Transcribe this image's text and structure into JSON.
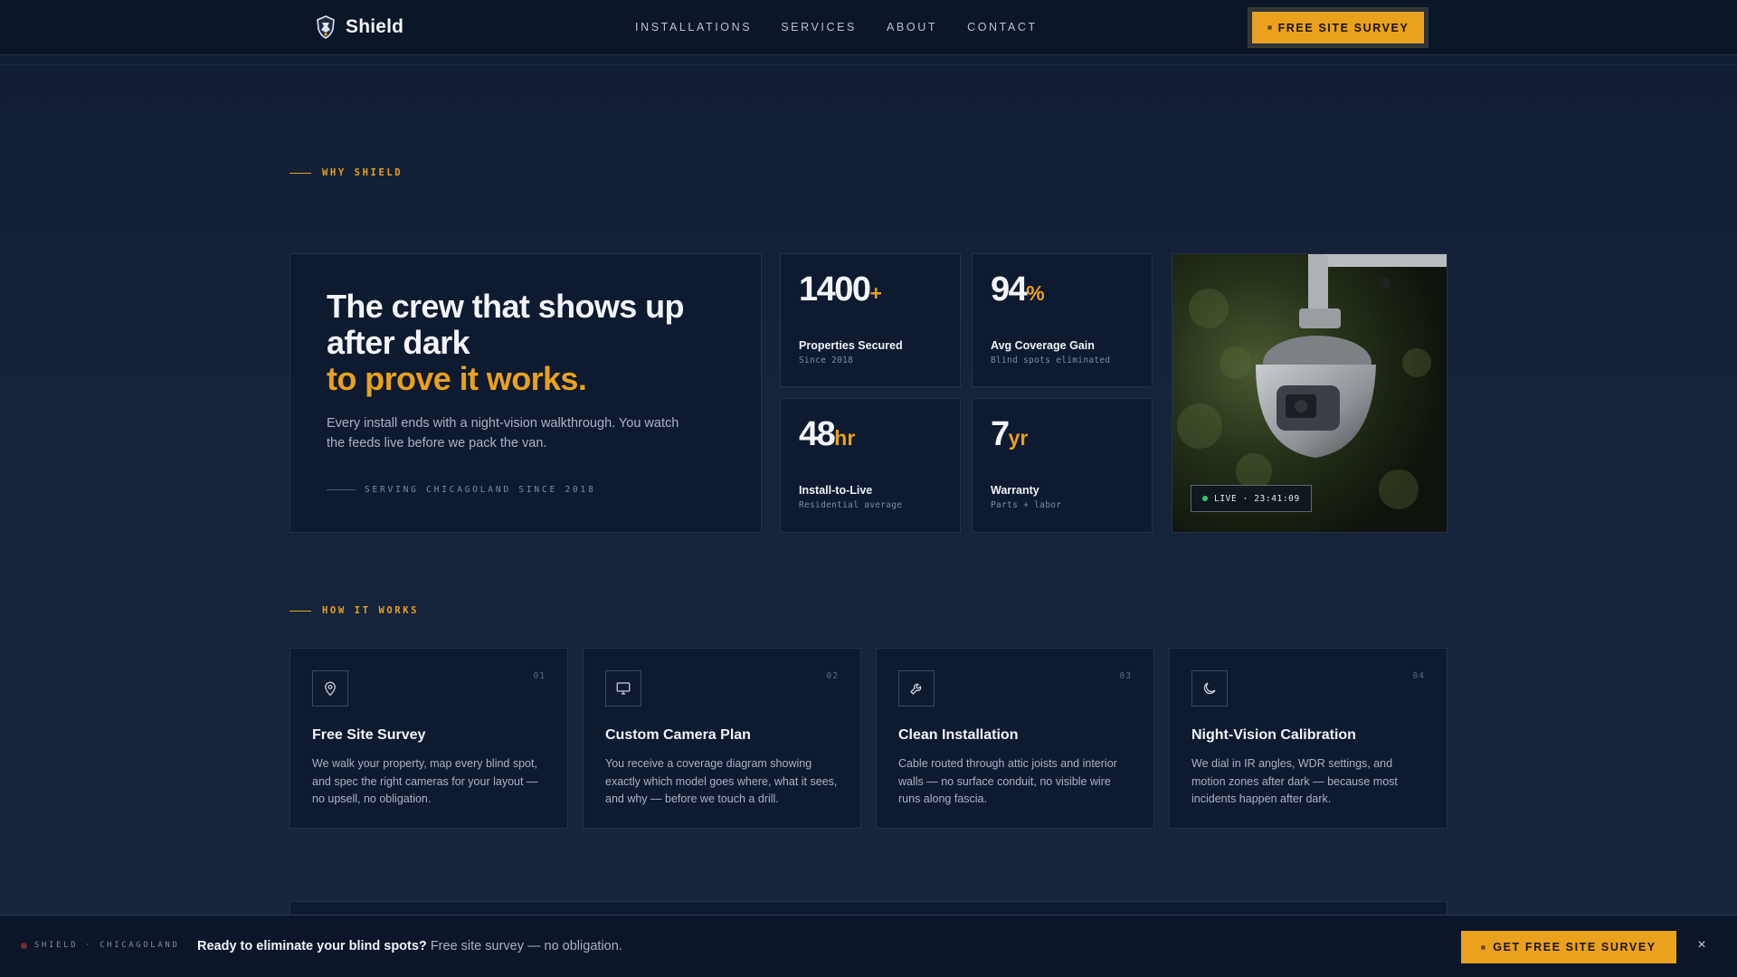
{
  "header": {
    "brand_name": "Shield",
    "nav": [
      "INSTALLATIONS",
      "SERVICES",
      "ABOUT",
      "CONTACT"
    ],
    "cta_label": "FREE SITE SURVEY"
  },
  "why": {
    "section_label": "WHY SHIELD",
    "title_line1": "The crew that shows up",
    "title_line2": "after dark",
    "title_accent": "to prove it works.",
    "description": "Every install ends with a night-vision walkthrough. You watch the feeds live before we pack the van.",
    "footnote": "SERVING CHICAGOLAND SINCE 2018",
    "stats": [
      {
        "value": "1400",
        "suffix": "+",
        "label": "Properties Secured",
        "sub": "Since 2018"
      },
      {
        "value": "94",
        "suffix": "%",
        "label": "Avg Coverage Gain",
        "sub": "Blind spots eliminated"
      },
      {
        "value": "48",
        "suffix": "hr",
        "label": "Install-to-Live",
        "sub": "Residential average"
      },
      {
        "value": "7",
        "suffix": "yr",
        "label": "Warranty",
        "sub": "Parts + labor"
      }
    ],
    "live_badge": "LIVE · 23:41:09"
  },
  "how": {
    "section_label": "HOW IT WORKS",
    "steps": [
      {
        "num": "01",
        "icon": "map-pin-icon",
        "title": "Free Site Survey",
        "desc": "We walk your property, map every blind spot, and spec the right cameras for your layout — no upsell, no obligation."
      },
      {
        "num": "02",
        "icon": "monitor-icon",
        "title": "Custom Camera Plan",
        "desc": "You receive a coverage diagram showing exactly which model goes where, what it sees, and why — before we touch a drill."
      },
      {
        "num": "03",
        "icon": "wrench-icon",
        "title": "Clean Installation",
        "desc": "Cable routed through attic joists and interior walls — no surface conduit, no visible wire runs along fascia."
      },
      {
        "num": "04",
        "icon": "moon-icon",
        "title": "Night-Vision Calibration",
        "desc": "We dial in IR angles, WDR settings, and motion zones after dark — because most incidents happen after dark."
      }
    ]
  },
  "bottom_bar": {
    "brand": "SHIELD · CHICAGOLAND",
    "headline": "Ready to eliminate your blind spots?",
    "subtext": " Free site survey — no obligation.",
    "cta_label": "GET FREE SITE SURVEY",
    "close": "×"
  },
  "colors": {
    "accent": "#e9a11e",
    "background": "#15223a",
    "card": "#0e1a30",
    "live": "#39c46a"
  }
}
